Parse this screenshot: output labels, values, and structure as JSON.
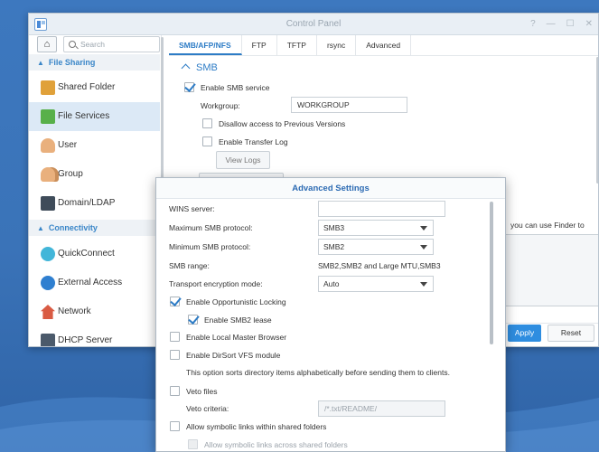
{
  "window": {
    "title": "Control Panel",
    "controls": [
      "?",
      "—",
      "☐",
      "✕"
    ]
  },
  "sidebar": {
    "search_placeholder": "Search",
    "sections": [
      {
        "label": "File Sharing"
      },
      {
        "label": "Connectivity"
      }
    ],
    "items": [
      {
        "label": "Shared Folder",
        "icon": "shared-folder-icon",
        "active": false
      },
      {
        "label": "File Services",
        "icon": "file-services-icon",
        "active": true
      },
      {
        "label": "User",
        "icon": "user-icon",
        "active": false
      },
      {
        "label": "Group",
        "icon": "group-icon",
        "active": false
      },
      {
        "label": "Domain/LDAP",
        "icon": "domain-ldap-icon",
        "active": false
      },
      {
        "label": "QuickConnect",
        "icon": "quickconnect-icon",
        "active": false
      },
      {
        "label": "External Access",
        "icon": "external-access-icon",
        "active": false
      },
      {
        "label": "Network",
        "icon": "network-icon",
        "active": false
      },
      {
        "label": "DHCP Server",
        "icon": "dhcp-server-icon",
        "active": false
      }
    ]
  },
  "tabs": [
    {
      "label": "SMB/AFP/NFS",
      "active": true
    },
    {
      "label": "FTP",
      "active": false
    },
    {
      "label": "TFTP",
      "active": false
    },
    {
      "label": "rsync",
      "active": false
    },
    {
      "label": "Advanced",
      "active": false
    }
  ],
  "smb": {
    "header": "SMB",
    "enable_label": "Enable SMB service",
    "enabled": true,
    "workgroup_label": "Workgroup:",
    "workgroup_value": "WORKGROUP",
    "disallow_label": "Disallow access to Previous Versions",
    "transfer_log_label": "Enable Transfer Log",
    "view_logs_label": "View Logs",
    "partial_text": "you can use Finder to"
  },
  "footer": {
    "apply_label": "Apply",
    "reset_label": "Reset"
  },
  "advanced": {
    "title": "Advanced Settings",
    "wins_label": "WINS server:",
    "wins_value": "",
    "max_proto_label": "Maximum SMB protocol:",
    "max_proto_value": "SMB3",
    "min_proto_label": "Minimum SMB protocol:",
    "min_proto_value": "SMB2",
    "range_label": "SMB range:",
    "range_value": "SMB2,SMB2 and Large MTU,SMB3",
    "encryption_label": "Transport encryption mode:",
    "encryption_value": "Auto",
    "oplock_label": "Enable Opportunistic Locking",
    "oplock_checked": true,
    "smb2_lease_label": "Enable SMB2 lease",
    "smb2_lease_checked": true,
    "local_master_label": "Enable Local Master Browser",
    "dirsort_label": "Enable DirSort VFS module",
    "dirsort_desc": "This option sorts directory items alphabetically before sending them to clients.",
    "veto_label": "Veto files",
    "veto_criteria_label": "Veto criteria:",
    "veto_criteria_placeholder": "/*.txt/README/",
    "symlinks_within_label": "Allow symbolic links within shared folders",
    "symlinks_across_label": "Allow symbolic links across shared folders"
  },
  "colors": {
    "accent": "#2d7cc6",
    "apply_button": "#2e8de0",
    "desktop": "#3a73b8"
  }
}
